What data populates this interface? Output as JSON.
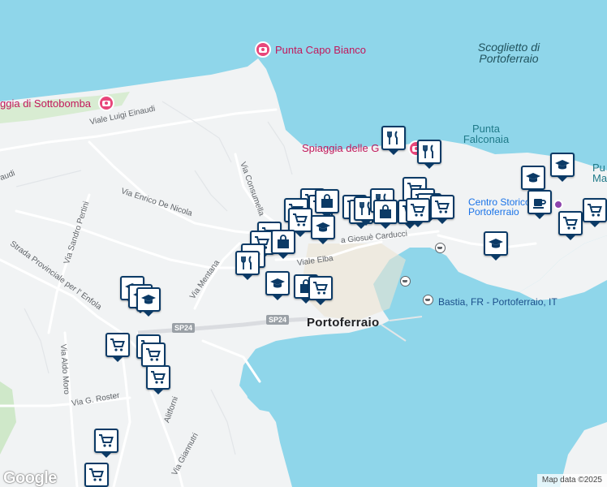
{
  "map": {
    "labels": {
      "punta_capo_bianco": "Punta Capo Bianco",
      "spiaggia_sottobomba": "ggia di Sottobomba",
      "scoglietto": "Scoglietto di Portoferraio",
      "punta_falconaia": "Punta Falconaia",
      "spiaggia_delle": "Spiaggia delle G",
      "punta_ma": "Pu\nMa",
      "centro_storico": "Centro Storico di Portoferraio",
      "bastia": "Bastia, FR - Portoferraio, IT",
      "town": "Portoferraio",
      "sp24_a": "SP24",
      "sp24_b": "SP24"
    },
    "streets": {
      "viale_luigi_einaudi": "Viale Luigi Einaudi",
      "audi": "audi",
      "via_consumella": "Via Consumella",
      "via_enrico_de_nicola": "Via Enrico De Nicola",
      "via_sandro_pertini": "Via Sandro Pertini",
      "strada_provinciale": "Strada Provinciale per l' Enfola",
      "via_mentana": "Via Mentana",
      "viale_elba": "Viale Elba",
      "via_giosue_carducci": "a Giosuè Carducci",
      "via_aldo_moro": "Via Aldo Moro",
      "via_g_roster": "Via G. Roster",
      "via_alitforni": "Alitforni",
      "via_giannutri": "Via Giannutri"
    },
    "attribution": "Map data ©2025",
    "logo": "Google",
    "colors": {
      "water": "#8fd6ea",
      "land": "#f1f3f4",
      "marker_border": "#0b3a66",
      "photo_pin": "#e8467a"
    }
  }
}
